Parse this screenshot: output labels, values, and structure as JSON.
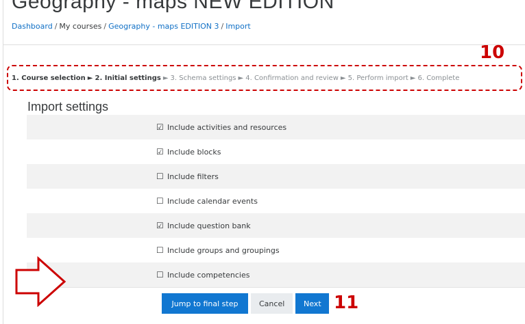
{
  "header": {
    "title": "Geography - maps NEW EDITION"
  },
  "breadcrumb": {
    "items": [
      "Dashboard",
      "My courses",
      "Geography - maps EDITION 3",
      "Import"
    ]
  },
  "annotations": {
    "label_10": "10",
    "label_11": "11"
  },
  "stepper": {
    "steps": [
      "1. Course selection",
      "2. Initial settings",
      "3. Schema settings",
      "4. Confirmation and review",
      "5. Perform import",
      "6. Complete"
    ]
  },
  "settings": {
    "title": "Import settings",
    "items": [
      {
        "label": "Include activities and resources",
        "checked": true
      },
      {
        "label": "Include blocks",
        "checked": true
      },
      {
        "label": "Include filters",
        "checked": false
      },
      {
        "label": "Include calendar events",
        "checked": false
      },
      {
        "label": "Include question bank",
        "checked": true
      },
      {
        "label": "Include groups and groupings",
        "checked": false
      },
      {
        "label": "Include competencies",
        "checked": false
      }
    ]
  },
  "buttons": {
    "jump": "Jump to final step",
    "cancel": "Cancel",
    "next": "Next"
  },
  "colors": {
    "annotation": "#cc0000",
    "link": "#0f6fc5",
    "primary_button": "#1177d1"
  },
  "icons": {
    "pointer_arrow": "arrow-right-outline-icon",
    "checked": "checkbox-checked-icon",
    "unchecked": "checkbox-unchecked-icon"
  }
}
